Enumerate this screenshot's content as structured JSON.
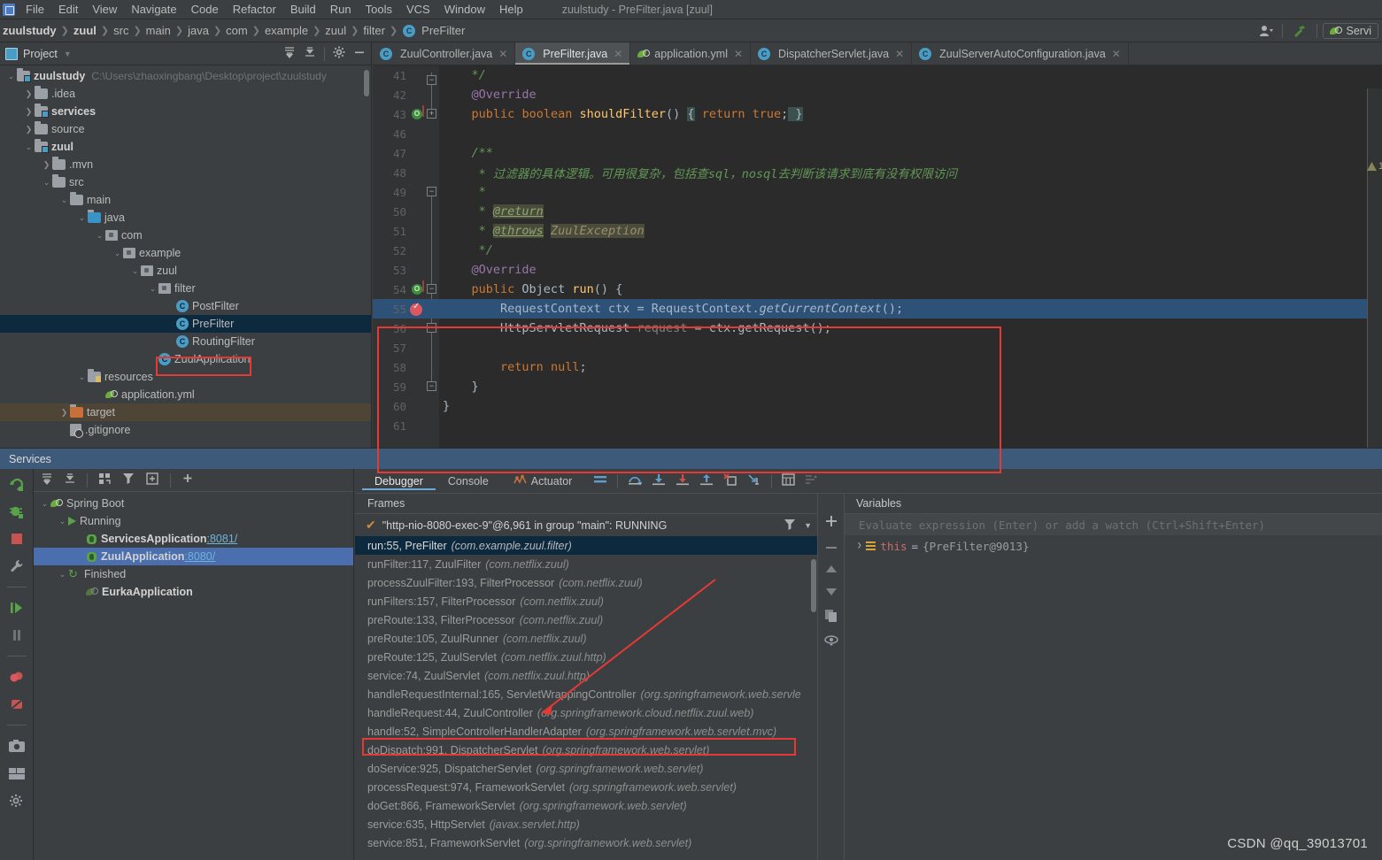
{
  "window": {
    "title": "zuulstudy - PreFilter.java [zuul]"
  },
  "menubar": {
    "items": [
      "File",
      "Edit",
      "View",
      "Navigate",
      "Code",
      "Refactor",
      "Build",
      "Run",
      "Tools",
      "VCS",
      "Window",
      "Help"
    ]
  },
  "navbar": {
    "crumbs": [
      "zuulstudy",
      "zuul",
      "src",
      "main",
      "java",
      "com",
      "example",
      "zuul",
      "filter"
    ],
    "class_crumb": "PreFilter",
    "class_badge": "C",
    "services_chip": "Servi"
  },
  "project": {
    "title": "Project",
    "tree": [
      {
        "label": "zuulstudy",
        "path": "C:\\Users\\zhaoxingbang\\Desktop\\project\\zuulstudy",
        "depth": 0,
        "arrow": "v",
        "icon": "folder-module",
        "bold": true
      },
      {
        "label": ".idea",
        "path": "",
        "depth": 1,
        "arrow": ">",
        "icon": "folder",
        "bold": false
      },
      {
        "label": "services",
        "path": "",
        "depth": 1,
        "arrow": ">",
        "icon": "folder-module",
        "bold": true
      },
      {
        "label": "source",
        "path": "",
        "depth": 1,
        "arrow": ">",
        "icon": "folder",
        "bold": false
      },
      {
        "label": "zuul",
        "path": "",
        "depth": 1,
        "arrow": "v",
        "icon": "folder-module",
        "bold": true
      },
      {
        "label": ".mvn",
        "path": "",
        "depth": 2,
        "arrow": ">",
        "icon": "folder",
        "bold": false
      },
      {
        "label": "src",
        "path": "",
        "depth": 2,
        "arrow": "v",
        "icon": "folder",
        "bold": false
      },
      {
        "label": "main",
        "path": "",
        "depth": 3,
        "arrow": "v",
        "icon": "folder",
        "bold": false
      },
      {
        "label": "java",
        "path": "",
        "depth": 4,
        "arrow": "v",
        "icon": "folder-source",
        "bold": false
      },
      {
        "label": "com",
        "path": "",
        "depth": 5,
        "arrow": "v",
        "icon": "package",
        "bold": false
      },
      {
        "label": "example",
        "path": "",
        "depth": 6,
        "arrow": "v",
        "icon": "package",
        "bold": false
      },
      {
        "label": "zuul",
        "path": "",
        "depth": 7,
        "arrow": "v",
        "icon": "package",
        "bold": false
      },
      {
        "label": "filter",
        "path": "",
        "depth": 8,
        "arrow": "v",
        "icon": "package",
        "bold": false
      },
      {
        "label": "PostFilter",
        "path": "",
        "depth": 9,
        "arrow": "",
        "icon": "class",
        "bold": false
      },
      {
        "label": "PreFilter",
        "path": "",
        "depth": 9,
        "arrow": "",
        "icon": "class",
        "bold": false,
        "selected": true,
        "highlighted": true
      },
      {
        "label": "RoutingFilter",
        "path": "",
        "depth": 9,
        "arrow": "",
        "icon": "class",
        "bold": false
      },
      {
        "label": "ZuulApplication",
        "path": "",
        "depth": 8,
        "arrow": "",
        "icon": "spring-class",
        "bold": false
      },
      {
        "label": "resources",
        "path": "",
        "depth": 4,
        "arrow": "v",
        "icon": "folder-resources",
        "bold": false
      },
      {
        "label": "application.yml",
        "path": "",
        "depth": 5,
        "arrow": "",
        "icon": "yml",
        "bold": false
      },
      {
        "label": "target",
        "path": "",
        "depth": 3,
        "arrow": ">",
        "icon": "folder-target",
        "bold": false,
        "target_sel": true
      },
      {
        "label": ".gitignore",
        "path": "",
        "depth": 3,
        "arrow": "",
        "icon": "git",
        "bold": false
      }
    ]
  },
  "editor": {
    "tabs": [
      {
        "label": "ZuulController.java",
        "icon": "java-class-icon",
        "active": false
      },
      {
        "label": "PreFilter.java",
        "icon": "java-class-icon",
        "active": true
      },
      {
        "label": "application.yml",
        "icon": "yml-icon",
        "active": false
      },
      {
        "label": "DispatcherServlet.java",
        "icon": "java-class-icon",
        "active": false
      },
      {
        "label": "ZuulServerAutoConfiguration.java",
        "icon": "java-class-icon",
        "active": false
      }
    ],
    "warning_count": "1",
    "lines": [
      {
        "num": "41",
        "text": "    */"
      },
      {
        "num": "42",
        "text": "    @Override"
      },
      {
        "num": "43",
        "text": "    public boolean shouldFilter() { return true; }"
      },
      {
        "num": "46",
        "text": ""
      },
      {
        "num": "47",
        "text": "    /**"
      },
      {
        "num": "48",
        "text": "     * 过滤器的具体逻辑。可用很复杂，包括查sql，nosql去判断该请求到底有没有权限访问"
      },
      {
        "num": "49",
        "text": "     *"
      },
      {
        "num": "50",
        "text": "     * @return"
      },
      {
        "num": "51",
        "text": "     * @throws ZuulException"
      },
      {
        "num": "52",
        "text": "     */"
      },
      {
        "num": "53",
        "text": "    @Override"
      },
      {
        "num": "54",
        "text": "    public Object run() {"
      },
      {
        "num": "55",
        "text": "        RequestContext ctx = RequestContext.getCurrentContext();"
      },
      {
        "num": "56",
        "text": "        HttpServletRequest request = ctx.getRequest();"
      },
      {
        "num": "57",
        "text": ""
      },
      {
        "num": "58",
        "text": "        return null;"
      },
      {
        "num": "59",
        "text": "    }"
      },
      {
        "num": "60",
        "text": "}"
      },
      {
        "num": "61",
        "text": ""
      }
    ]
  },
  "services": {
    "header": "Services",
    "tree": [
      {
        "label": "Spring Boot",
        "depth": 0,
        "arrow": "v",
        "icon": "spring-icon"
      },
      {
        "label": "Running",
        "depth": 1,
        "arrow": "v",
        "icon": "run-icon"
      },
      {
        "label": "ServicesApplication",
        "suffix": ":8081/",
        "depth": 2,
        "arrow": "",
        "icon": "debug-bug-icon",
        "bold": true
      },
      {
        "label": "ZuulApplication",
        "suffix": ":8080/",
        "depth": 2,
        "arrow": "",
        "icon": "debug-bug-icon",
        "bold": true,
        "selected": true
      },
      {
        "label": "Finished",
        "depth": 1,
        "arrow": "v",
        "icon": "rerun-icon"
      },
      {
        "label": "EurkaApplication",
        "suffix": "",
        "depth": 2,
        "arrow": "",
        "icon": "spring-icon-grey",
        "bold": true
      }
    ]
  },
  "debugger": {
    "tabs": [
      {
        "label": "Debugger",
        "active": true
      },
      {
        "label": "Console",
        "active": false
      },
      {
        "label": "Actuator",
        "active": false,
        "icon": "actuator-icon"
      }
    ],
    "frames_header": "Frames",
    "variables_header": "Variables",
    "thread": "\"http-nio-8080-exec-9\"@6,961 in group \"main\": RUNNING",
    "frames": [
      {
        "method": "run:55, PreFilter",
        "pkg": "(com.example.zuul.filter)",
        "selected": true
      },
      {
        "method": "runFilter:117, ZuulFilter",
        "pkg": "(com.netflix.zuul)"
      },
      {
        "method": "processZuulFilter:193, FilterProcessor",
        "pkg": "(com.netflix.zuul)"
      },
      {
        "method": "runFilters:157, FilterProcessor",
        "pkg": "(com.netflix.zuul)"
      },
      {
        "method": "preRoute:133, FilterProcessor",
        "pkg": "(com.netflix.zuul)"
      },
      {
        "method": "preRoute:105, ZuulRunner",
        "pkg": "(com.netflix.zuul)"
      },
      {
        "method": "preRoute:125, ZuulServlet",
        "pkg": "(com.netflix.zuul.http)"
      },
      {
        "method": "service:74, ZuulServlet",
        "pkg": "(com.netflix.zuul.http)"
      },
      {
        "method": "handleRequestInternal:165, ServletWrappingController",
        "pkg": "(org.springframework.web.servle"
      },
      {
        "method": "handleRequest:44, ZuulController",
        "pkg": "(org.springframework.cloud.netflix.zuul.web)",
        "highlighted": true
      },
      {
        "method": "handle:52, SimpleControllerHandlerAdapter",
        "pkg": "(org.springframework.web.servlet.mvc)"
      },
      {
        "method": "doDispatch:991, DispatcherServlet",
        "pkg": "(org.springframework.web.servlet)"
      },
      {
        "method": "doService:925, DispatcherServlet",
        "pkg": "(org.springframework.web.servlet)"
      },
      {
        "method": "processRequest:974, FrameworkServlet",
        "pkg": "(org.springframework.web.servlet)"
      },
      {
        "method": "doGet:866, FrameworkServlet",
        "pkg": "(org.springframework.web.servlet)"
      },
      {
        "method": "service:635, HttpServlet",
        "pkg": "(javax.servlet.http)"
      },
      {
        "method": "service:851, FrameworkServlet",
        "pkg": "(org.springframework.web.servlet)"
      }
    ],
    "evaluate_placeholder": "Evaluate expression (Enter) or add a watch (Ctrl+Shift+Enter)",
    "variables": [
      {
        "name": "this",
        "eq": " = ",
        "value": "{PreFilter@9013}"
      }
    ]
  },
  "watermark": "CSDN @qq_39013701",
  "colors": {
    "accent_blue": "#4b6eaf",
    "selection_blue": "#2d5177",
    "annotation_red": "#e53935",
    "keyword_orange": "#cc7832",
    "comment_green": "#629755",
    "method_yellow": "#ffc66d"
  }
}
